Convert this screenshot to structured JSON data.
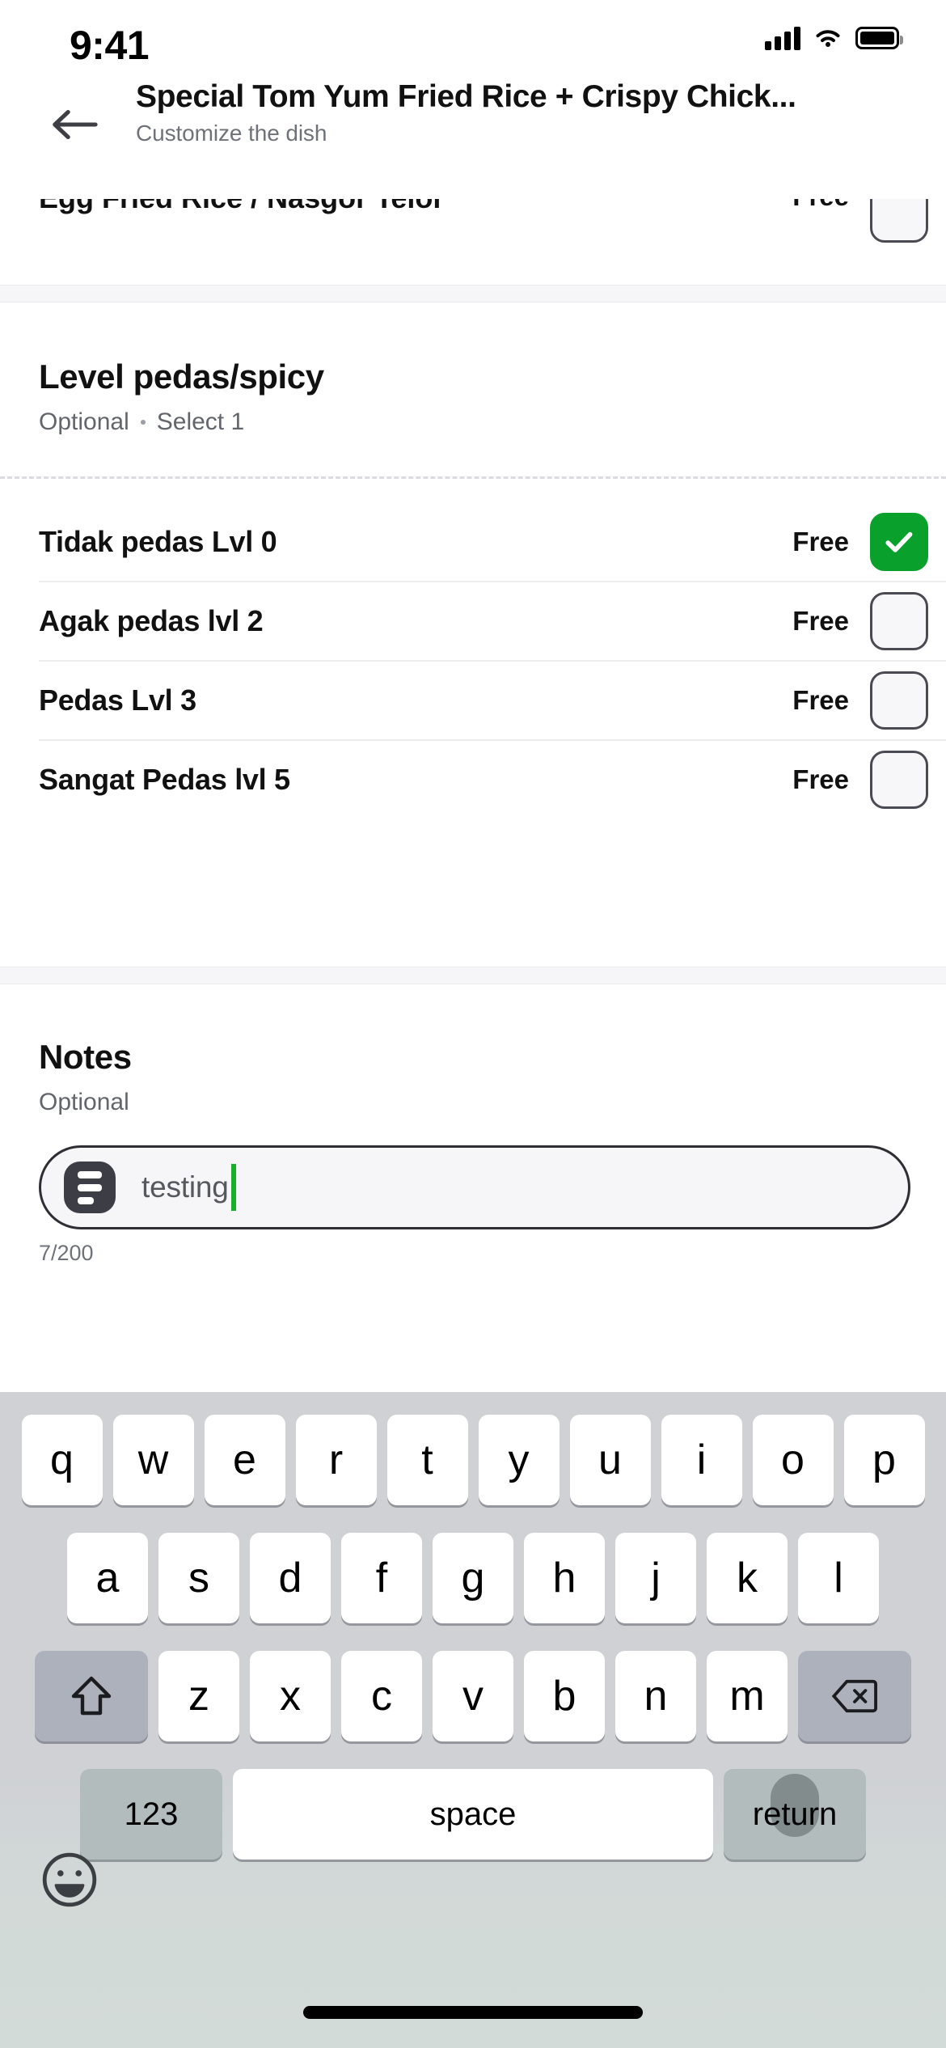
{
  "status_bar": {
    "time": "9:41",
    "icons": [
      "cellular-signal-icon",
      "wifi-icon",
      "battery-icon"
    ]
  },
  "header": {
    "back_icon": "back-arrow-icon",
    "title": "Special Tom Yum Fried Rice + Crispy Chick...",
    "subtitle": "Customize the dish"
  },
  "clipped_section": {
    "option_label": "Egg Fried Rice / Nasgor Telor",
    "option_price": "Free",
    "checked": false
  },
  "spicy_section": {
    "title": "Level pedas/spicy",
    "required_label": "Optional",
    "select_label": "Select 1",
    "options": [
      {
        "label": "Tidak pedas Lvl 0",
        "price": "Free",
        "checked": true
      },
      {
        "label": "Agak pedas lvl 2",
        "price": "Free",
        "checked": false
      },
      {
        "label": "Pedas Lvl 3",
        "price": "Free",
        "checked": false
      },
      {
        "label": "Sangat Pedas lvl 5",
        "price": "Free",
        "checked": false
      }
    ]
  },
  "notes_section": {
    "title": "Notes",
    "required_label": "Optional",
    "icon": "note-lines-icon",
    "value": "testing",
    "placeholder": "Add a note",
    "counter": "7/200"
  },
  "keyboard": {
    "row1": [
      "q",
      "w",
      "e",
      "r",
      "t",
      "y",
      "u",
      "i",
      "o",
      "p"
    ],
    "row2": [
      "a",
      "s",
      "d",
      "f",
      "g",
      "h",
      "j",
      "k",
      "l"
    ],
    "row3": [
      "z",
      "x",
      "c",
      "v",
      "b",
      "n",
      "m"
    ],
    "shift_icon": "shift-arrow-icon",
    "backspace_icon": "backspace-icon",
    "numeric_label": "123",
    "space_label": "space",
    "return_label": "return",
    "emoji_icon": "emoji-smiley-icon"
  },
  "colors": {
    "accent_green": "#0aa02c",
    "caret_green": "#17b028",
    "checkbox_border": "#4a4a52",
    "keyboard_bg": "#cfd1d5",
    "keyboard_bottom": "#d3dbd9"
  }
}
